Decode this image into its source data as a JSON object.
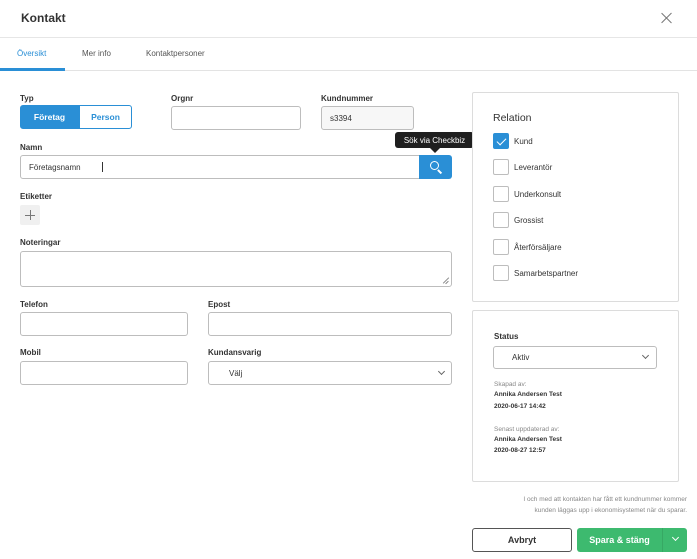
{
  "dialog": {
    "title": "Kontakt"
  },
  "tabs": [
    {
      "label": "Översikt",
      "active": true
    },
    {
      "label": "Mer info",
      "active": false
    },
    {
      "label": "Kontaktpersoner",
      "active": false
    }
  ],
  "form": {
    "type": {
      "label": "Typ",
      "options": [
        "Företag",
        "Person"
      ],
      "selected": "Företag"
    },
    "orgnr": {
      "label": "Orgnr",
      "value": ""
    },
    "customer_number": {
      "label": "Kundnummer",
      "value": "s3394"
    },
    "name": {
      "label": "Namn",
      "value": "Företagsnamn"
    },
    "search_tooltip": "Sök via Checkbiz",
    "tags": {
      "label": "Etiketter"
    },
    "notes": {
      "label": "Noteringar",
      "value": ""
    },
    "phone": {
      "label": "Telefon",
      "value": ""
    },
    "email": {
      "label": "Epost",
      "value": ""
    },
    "mobile": {
      "label": "Mobil",
      "value": ""
    },
    "responsible": {
      "label": "Kundansvarig",
      "value": "Välj"
    }
  },
  "relation": {
    "title": "Relation",
    "items": [
      {
        "label": "Kund",
        "checked": true
      },
      {
        "label": "Leverantör",
        "checked": false
      },
      {
        "label": "Underkonsult",
        "checked": false
      },
      {
        "label": "Grossist",
        "checked": false
      },
      {
        "label": "Återförsäljare",
        "checked": false
      },
      {
        "label": "Samarbetspartner",
        "checked": false
      }
    ]
  },
  "status": {
    "label": "Status",
    "value": "Aktiv",
    "created_label": "Skapad av:",
    "created_by": "Annika Andersen Test",
    "created_at": "2020-06-17 14:42",
    "updated_label": "Senast uppdaterad av:",
    "updated_by": "Annika Andersen Test",
    "updated_at": "2020-08-27 12:57"
  },
  "footnote": {
    "line1": "I och med att kontakten har fått ett kundnummer kommer",
    "line2": "kunden läggas upp i ekonomisystemet när du sparar."
  },
  "actions": {
    "cancel": "Avbryt",
    "save": "Spara & stäng"
  },
  "colors": {
    "primary": "#2a8fd6",
    "success": "#3dba6f",
    "text": "#333333",
    "border": "#bdbdbd"
  }
}
